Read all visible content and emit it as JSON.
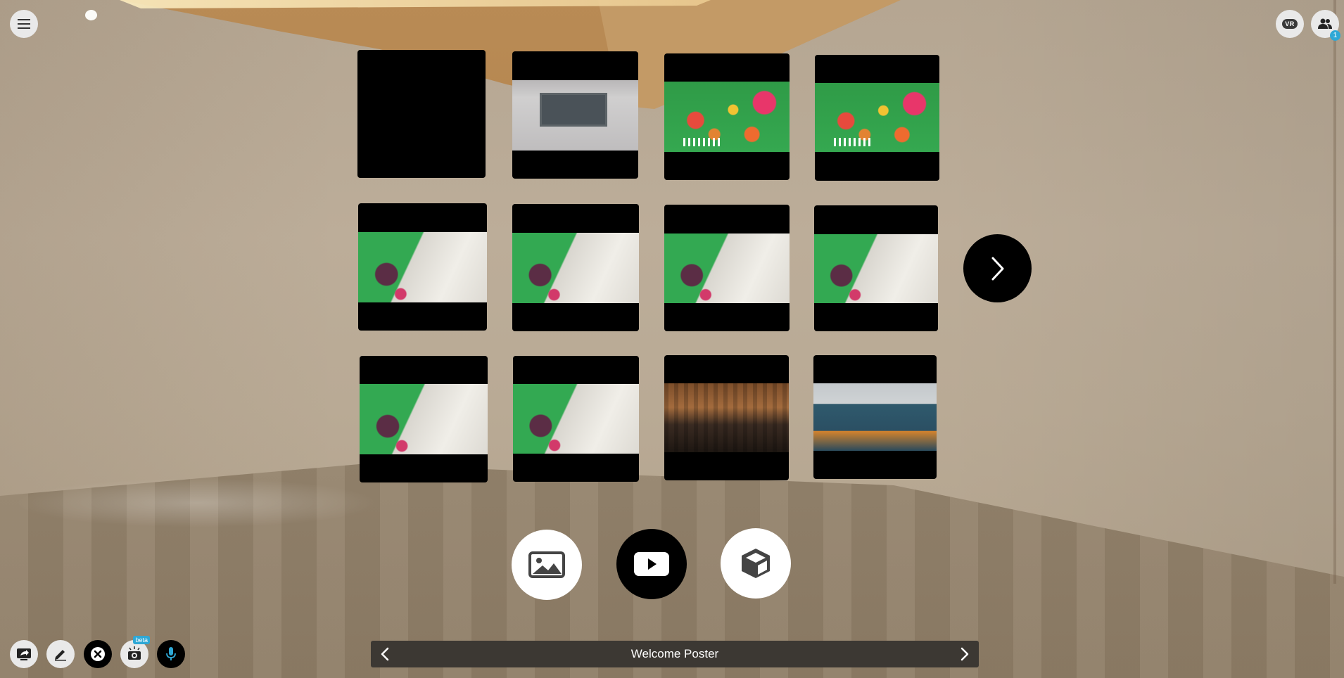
{
  "topbar": {
    "menu_icon": "hamburger-menu-icon",
    "vr_label": "VR",
    "people_count": "1"
  },
  "gallery": {
    "tiles": [
      {
        "thumb": "blank"
      },
      {
        "thumb": "station-sign"
      },
      {
        "thumb": "green-collage"
      },
      {
        "thumb": "green-collage"
      },
      {
        "thumb": "green-white-flower"
      },
      {
        "thumb": "green-white-flower"
      },
      {
        "thumb": "green-white-flower"
      },
      {
        "thumb": "green-white-flower"
      },
      {
        "thumb": "green-white-flower"
      },
      {
        "thumb": "green-white-flower"
      },
      {
        "thumb": "concert-hall"
      },
      {
        "thumb": "train-meal-deals"
      }
    ],
    "next_icon": "chevron-right-icon"
  },
  "media_types": [
    {
      "name": "image",
      "icon": "image-icon",
      "selected": false
    },
    {
      "name": "video",
      "icon": "play-icon",
      "selected": true
    },
    {
      "name": "3d-model",
      "icon": "cube-icon",
      "selected": false
    }
  ],
  "toolbar": {
    "beta_label": "beta",
    "items": [
      "share-screen-icon",
      "pen-icon",
      "close-icon",
      "camera-effects-icon",
      "microphone-icon"
    ]
  },
  "navbar": {
    "title": "Welcome Poster"
  },
  "colors": {
    "accent": "#2ea8d6",
    "navbar_bg": "#3c3833"
  }
}
